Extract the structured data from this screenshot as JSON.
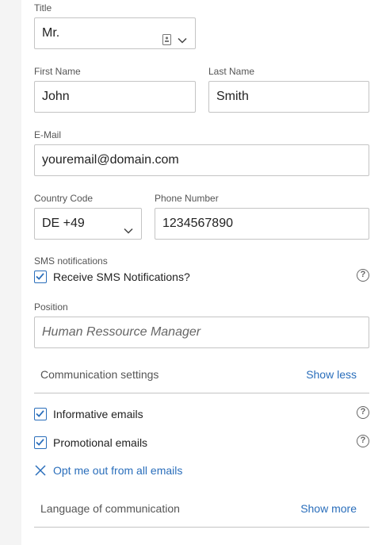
{
  "form": {
    "title": {
      "label": "Title",
      "value": "Mr."
    },
    "first_name": {
      "label": "First Name",
      "value": "John"
    },
    "last_name": {
      "label": "Last Name",
      "value": "Smith"
    },
    "email": {
      "label": "E-Mail",
      "value": "youremail@domain.com"
    },
    "country_code": {
      "label": "Country Code",
      "value": "DE +49"
    },
    "phone": {
      "label": "Phone Number",
      "value": "1234567890"
    },
    "sms": {
      "section_label": "SMS notifications",
      "checkbox_label": "Receive SMS Notifications?",
      "checked": true,
      "help_glyph": "?"
    },
    "position": {
      "label": "Position",
      "placeholder": "Human Ressource Manager"
    }
  },
  "communication": {
    "title": "Communication settings",
    "toggle_label": "Show less",
    "informative": {
      "label": "Informative emails",
      "checked": true,
      "help_glyph": "?"
    },
    "promotional": {
      "label": "Promotional emails",
      "checked": true,
      "help_glyph": "?"
    },
    "optout_label": "Opt me out from all emails"
  },
  "language": {
    "title": "Language of communication",
    "toggle_label": "Show more"
  },
  "colors": {
    "accent": "#2a6ebb",
    "border": "#c4c4c4",
    "page_bg": "#f4f4f4"
  }
}
